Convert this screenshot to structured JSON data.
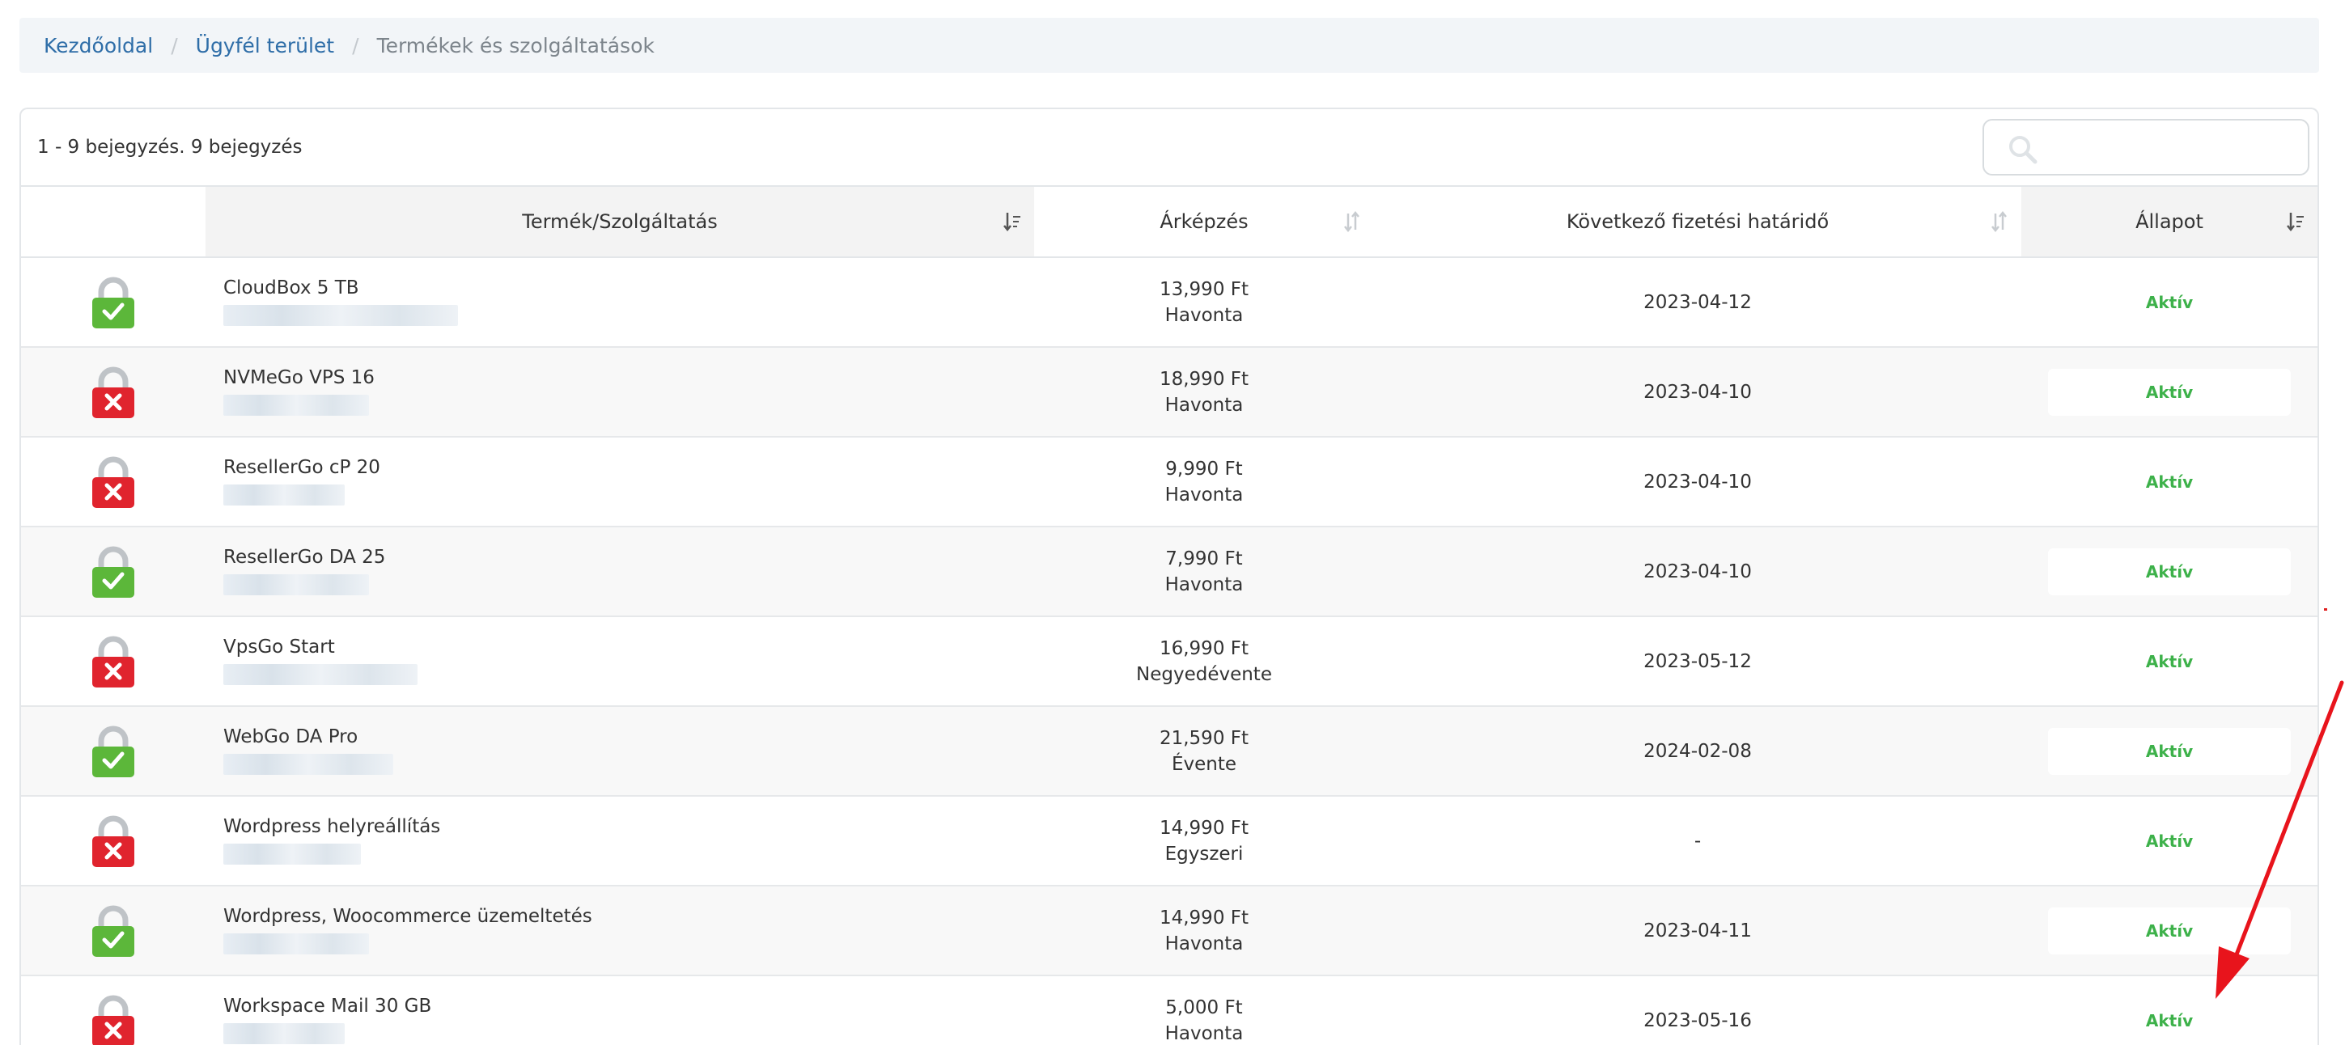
{
  "breadcrumb": {
    "home": "Kezdőoldal",
    "client_area": "Ügyfél terület",
    "current": "Termékek és szolgáltatások"
  },
  "table_info": "1 - 9 bejegyzés. 9 bejegyzés",
  "search": {
    "placeholder": "",
    "value": ""
  },
  "columns": {
    "product": "Termék/Szolgáltatás",
    "pricing": "Árképzés",
    "next_due": "Következő fizetési határidő",
    "status": "Állapot"
  },
  "rows": [
    {
      "product": "CloudBox 5 TB",
      "price": "13,990 Ft",
      "cycle": "Havonta",
      "due": "2023-04-12",
      "status": "Aktív",
      "lock": "green"
    },
    {
      "product": "NVMeGo VPS 16",
      "price": "18,990 Ft",
      "cycle": "Havonta",
      "due": "2023-04-10",
      "status": "Aktív",
      "lock": "red"
    },
    {
      "product": "ResellerGo cP 20",
      "price": "9,990 Ft",
      "cycle": "Havonta",
      "due": "2023-04-10",
      "status": "Aktív",
      "lock": "red"
    },
    {
      "product": "ResellerGo DA 25",
      "price": "7,990 Ft",
      "cycle": "Havonta",
      "due": "2023-04-10",
      "status": "Aktív",
      "lock": "green"
    },
    {
      "product": "VpsGo Start",
      "price": "16,990 Ft",
      "cycle": "Negyedévente",
      "due": "2023-05-12",
      "status": "Aktív",
      "lock": "red"
    },
    {
      "product": "WebGo DA Pro",
      "price": "21,590 Ft",
      "cycle": "Évente",
      "due": "2024-02-08",
      "status": "Aktív",
      "lock": "green"
    },
    {
      "product": "Wordpress helyreállítás",
      "price": "14,990 Ft",
      "cycle": "Egyszeri",
      "due": "-",
      "status": "Aktív",
      "lock": "red"
    },
    {
      "product": "Wordpress, Woocommerce üzemeltetés",
      "price": "14,990 Ft",
      "cycle": "Havonta",
      "due": "2023-04-11",
      "status": "Aktív",
      "lock": "green"
    },
    {
      "product": "Workspace Mail 30 GB",
      "price": "5,000 Ft",
      "cycle": "Havonta",
      "due": "2023-05-16",
      "status": "Aktív",
      "lock": "red"
    }
  ],
  "colors": {
    "lock_green": "#5cb73a",
    "lock_red": "#e0242e",
    "active": "#3db14a",
    "link": "#2f6ea8",
    "arrow": "#e8141c"
  },
  "icons": [
    "lock-open-icon",
    "lock-closed-icon",
    "search-icon",
    "sort-icon",
    "red-arrow-annotation"
  ]
}
